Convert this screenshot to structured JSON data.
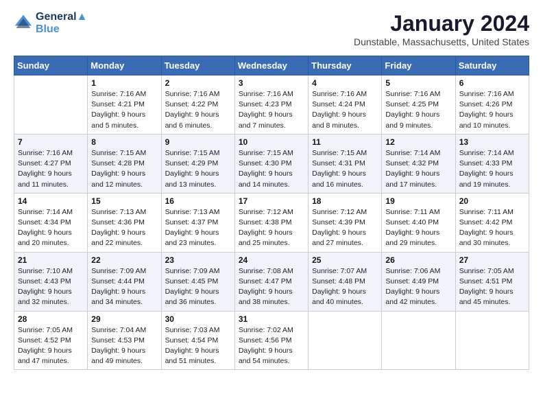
{
  "header": {
    "logo_line1": "General",
    "logo_line2": "Blue",
    "month_year": "January 2024",
    "location": "Dunstable, Massachusetts, United States"
  },
  "weekdays": [
    "Sunday",
    "Monday",
    "Tuesday",
    "Wednesday",
    "Thursday",
    "Friday",
    "Saturday"
  ],
  "weeks": [
    [
      {
        "day": "",
        "info": ""
      },
      {
        "day": "1",
        "info": "Sunrise: 7:16 AM\nSunset: 4:21 PM\nDaylight: 9 hours\nand 5 minutes."
      },
      {
        "day": "2",
        "info": "Sunrise: 7:16 AM\nSunset: 4:22 PM\nDaylight: 9 hours\nand 6 minutes."
      },
      {
        "day": "3",
        "info": "Sunrise: 7:16 AM\nSunset: 4:23 PM\nDaylight: 9 hours\nand 7 minutes."
      },
      {
        "day": "4",
        "info": "Sunrise: 7:16 AM\nSunset: 4:24 PM\nDaylight: 9 hours\nand 8 minutes."
      },
      {
        "day": "5",
        "info": "Sunrise: 7:16 AM\nSunset: 4:25 PM\nDaylight: 9 hours\nand 9 minutes."
      },
      {
        "day": "6",
        "info": "Sunrise: 7:16 AM\nSunset: 4:26 PM\nDaylight: 9 hours\nand 10 minutes."
      }
    ],
    [
      {
        "day": "7",
        "info": "Sunrise: 7:16 AM\nSunset: 4:27 PM\nDaylight: 9 hours\nand 11 minutes."
      },
      {
        "day": "8",
        "info": "Sunrise: 7:15 AM\nSunset: 4:28 PM\nDaylight: 9 hours\nand 12 minutes."
      },
      {
        "day": "9",
        "info": "Sunrise: 7:15 AM\nSunset: 4:29 PM\nDaylight: 9 hours\nand 13 minutes."
      },
      {
        "day": "10",
        "info": "Sunrise: 7:15 AM\nSunset: 4:30 PM\nDaylight: 9 hours\nand 14 minutes."
      },
      {
        "day": "11",
        "info": "Sunrise: 7:15 AM\nSunset: 4:31 PM\nDaylight: 9 hours\nand 16 minutes."
      },
      {
        "day": "12",
        "info": "Sunrise: 7:14 AM\nSunset: 4:32 PM\nDaylight: 9 hours\nand 17 minutes."
      },
      {
        "day": "13",
        "info": "Sunrise: 7:14 AM\nSunset: 4:33 PM\nDaylight: 9 hours\nand 19 minutes."
      }
    ],
    [
      {
        "day": "14",
        "info": "Sunrise: 7:14 AM\nSunset: 4:34 PM\nDaylight: 9 hours\nand 20 minutes."
      },
      {
        "day": "15",
        "info": "Sunrise: 7:13 AM\nSunset: 4:36 PM\nDaylight: 9 hours\nand 22 minutes."
      },
      {
        "day": "16",
        "info": "Sunrise: 7:13 AM\nSunset: 4:37 PM\nDaylight: 9 hours\nand 23 minutes."
      },
      {
        "day": "17",
        "info": "Sunrise: 7:12 AM\nSunset: 4:38 PM\nDaylight: 9 hours\nand 25 minutes."
      },
      {
        "day": "18",
        "info": "Sunrise: 7:12 AM\nSunset: 4:39 PM\nDaylight: 9 hours\nand 27 minutes."
      },
      {
        "day": "19",
        "info": "Sunrise: 7:11 AM\nSunset: 4:40 PM\nDaylight: 9 hours\nand 29 minutes."
      },
      {
        "day": "20",
        "info": "Sunrise: 7:11 AM\nSunset: 4:42 PM\nDaylight: 9 hours\nand 30 minutes."
      }
    ],
    [
      {
        "day": "21",
        "info": "Sunrise: 7:10 AM\nSunset: 4:43 PM\nDaylight: 9 hours\nand 32 minutes."
      },
      {
        "day": "22",
        "info": "Sunrise: 7:09 AM\nSunset: 4:44 PM\nDaylight: 9 hours\nand 34 minutes."
      },
      {
        "day": "23",
        "info": "Sunrise: 7:09 AM\nSunset: 4:45 PM\nDaylight: 9 hours\nand 36 minutes."
      },
      {
        "day": "24",
        "info": "Sunrise: 7:08 AM\nSunset: 4:47 PM\nDaylight: 9 hours\nand 38 minutes."
      },
      {
        "day": "25",
        "info": "Sunrise: 7:07 AM\nSunset: 4:48 PM\nDaylight: 9 hours\nand 40 minutes."
      },
      {
        "day": "26",
        "info": "Sunrise: 7:06 AM\nSunset: 4:49 PM\nDaylight: 9 hours\nand 42 minutes."
      },
      {
        "day": "27",
        "info": "Sunrise: 7:05 AM\nSunset: 4:51 PM\nDaylight: 9 hours\nand 45 minutes."
      }
    ],
    [
      {
        "day": "28",
        "info": "Sunrise: 7:05 AM\nSunset: 4:52 PM\nDaylight: 9 hours\nand 47 minutes."
      },
      {
        "day": "29",
        "info": "Sunrise: 7:04 AM\nSunset: 4:53 PM\nDaylight: 9 hours\nand 49 minutes."
      },
      {
        "day": "30",
        "info": "Sunrise: 7:03 AM\nSunset: 4:54 PM\nDaylight: 9 hours\nand 51 minutes."
      },
      {
        "day": "31",
        "info": "Sunrise: 7:02 AM\nSunset: 4:56 PM\nDaylight: 9 hours\nand 54 minutes."
      },
      {
        "day": "",
        "info": ""
      },
      {
        "day": "",
        "info": ""
      },
      {
        "day": "",
        "info": ""
      }
    ]
  ]
}
